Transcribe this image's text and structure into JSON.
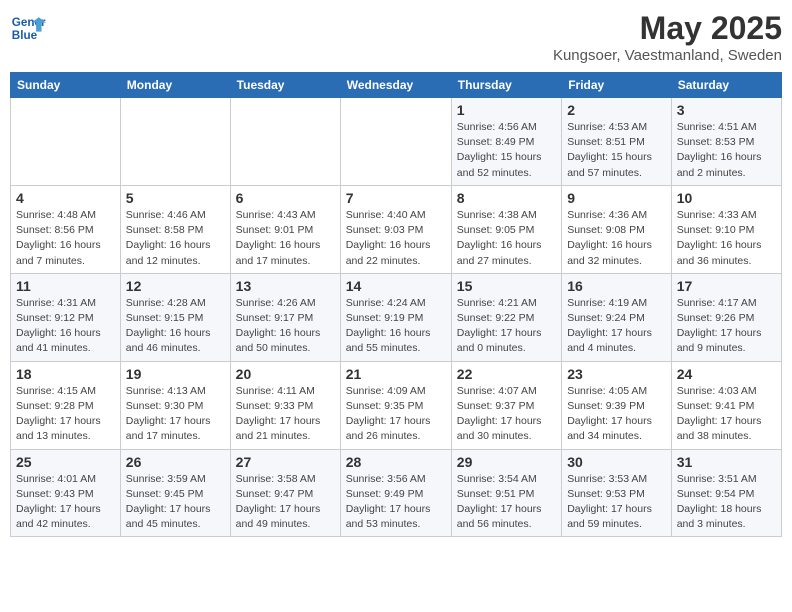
{
  "header": {
    "logo_line1": "General",
    "logo_line2": "Blue",
    "month": "May 2025",
    "location": "Kungsoer, Vaestmanland, Sweden"
  },
  "weekdays": [
    "Sunday",
    "Monday",
    "Tuesday",
    "Wednesday",
    "Thursday",
    "Friday",
    "Saturday"
  ],
  "weeks": [
    [
      {
        "day": "",
        "info": ""
      },
      {
        "day": "",
        "info": ""
      },
      {
        "day": "",
        "info": ""
      },
      {
        "day": "",
        "info": ""
      },
      {
        "day": "1",
        "info": "Sunrise: 4:56 AM\nSunset: 8:49 PM\nDaylight: 15 hours\nand 52 minutes."
      },
      {
        "day": "2",
        "info": "Sunrise: 4:53 AM\nSunset: 8:51 PM\nDaylight: 15 hours\nand 57 minutes."
      },
      {
        "day": "3",
        "info": "Sunrise: 4:51 AM\nSunset: 8:53 PM\nDaylight: 16 hours\nand 2 minutes."
      }
    ],
    [
      {
        "day": "4",
        "info": "Sunrise: 4:48 AM\nSunset: 8:56 PM\nDaylight: 16 hours\nand 7 minutes."
      },
      {
        "day": "5",
        "info": "Sunrise: 4:46 AM\nSunset: 8:58 PM\nDaylight: 16 hours\nand 12 minutes."
      },
      {
        "day": "6",
        "info": "Sunrise: 4:43 AM\nSunset: 9:01 PM\nDaylight: 16 hours\nand 17 minutes."
      },
      {
        "day": "7",
        "info": "Sunrise: 4:40 AM\nSunset: 9:03 PM\nDaylight: 16 hours\nand 22 minutes."
      },
      {
        "day": "8",
        "info": "Sunrise: 4:38 AM\nSunset: 9:05 PM\nDaylight: 16 hours\nand 27 minutes."
      },
      {
        "day": "9",
        "info": "Sunrise: 4:36 AM\nSunset: 9:08 PM\nDaylight: 16 hours\nand 32 minutes."
      },
      {
        "day": "10",
        "info": "Sunrise: 4:33 AM\nSunset: 9:10 PM\nDaylight: 16 hours\nand 36 minutes."
      }
    ],
    [
      {
        "day": "11",
        "info": "Sunrise: 4:31 AM\nSunset: 9:12 PM\nDaylight: 16 hours\nand 41 minutes."
      },
      {
        "day": "12",
        "info": "Sunrise: 4:28 AM\nSunset: 9:15 PM\nDaylight: 16 hours\nand 46 minutes."
      },
      {
        "day": "13",
        "info": "Sunrise: 4:26 AM\nSunset: 9:17 PM\nDaylight: 16 hours\nand 50 minutes."
      },
      {
        "day": "14",
        "info": "Sunrise: 4:24 AM\nSunset: 9:19 PM\nDaylight: 16 hours\nand 55 minutes."
      },
      {
        "day": "15",
        "info": "Sunrise: 4:21 AM\nSunset: 9:22 PM\nDaylight: 17 hours\nand 0 minutes."
      },
      {
        "day": "16",
        "info": "Sunrise: 4:19 AM\nSunset: 9:24 PM\nDaylight: 17 hours\nand 4 minutes."
      },
      {
        "day": "17",
        "info": "Sunrise: 4:17 AM\nSunset: 9:26 PM\nDaylight: 17 hours\nand 9 minutes."
      }
    ],
    [
      {
        "day": "18",
        "info": "Sunrise: 4:15 AM\nSunset: 9:28 PM\nDaylight: 17 hours\nand 13 minutes."
      },
      {
        "day": "19",
        "info": "Sunrise: 4:13 AM\nSunset: 9:30 PM\nDaylight: 17 hours\nand 17 minutes."
      },
      {
        "day": "20",
        "info": "Sunrise: 4:11 AM\nSunset: 9:33 PM\nDaylight: 17 hours\nand 21 minutes."
      },
      {
        "day": "21",
        "info": "Sunrise: 4:09 AM\nSunset: 9:35 PM\nDaylight: 17 hours\nand 26 minutes."
      },
      {
        "day": "22",
        "info": "Sunrise: 4:07 AM\nSunset: 9:37 PM\nDaylight: 17 hours\nand 30 minutes."
      },
      {
        "day": "23",
        "info": "Sunrise: 4:05 AM\nSunset: 9:39 PM\nDaylight: 17 hours\nand 34 minutes."
      },
      {
        "day": "24",
        "info": "Sunrise: 4:03 AM\nSunset: 9:41 PM\nDaylight: 17 hours\nand 38 minutes."
      }
    ],
    [
      {
        "day": "25",
        "info": "Sunrise: 4:01 AM\nSunset: 9:43 PM\nDaylight: 17 hours\nand 42 minutes."
      },
      {
        "day": "26",
        "info": "Sunrise: 3:59 AM\nSunset: 9:45 PM\nDaylight: 17 hours\nand 45 minutes."
      },
      {
        "day": "27",
        "info": "Sunrise: 3:58 AM\nSunset: 9:47 PM\nDaylight: 17 hours\nand 49 minutes."
      },
      {
        "day": "28",
        "info": "Sunrise: 3:56 AM\nSunset: 9:49 PM\nDaylight: 17 hours\nand 53 minutes."
      },
      {
        "day": "29",
        "info": "Sunrise: 3:54 AM\nSunset: 9:51 PM\nDaylight: 17 hours\nand 56 minutes."
      },
      {
        "day": "30",
        "info": "Sunrise: 3:53 AM\nSunset: 9:53 PM\nDaylight: 17 hours\nand 59 minutes."
      },
      {
        "day": "31",
        "info": "Sunrise: 3:51 AM\nSunset: 9:54 PM\nDaylight: 18 hours\nand 3 minutes."
      }
    ]
  ]
}
